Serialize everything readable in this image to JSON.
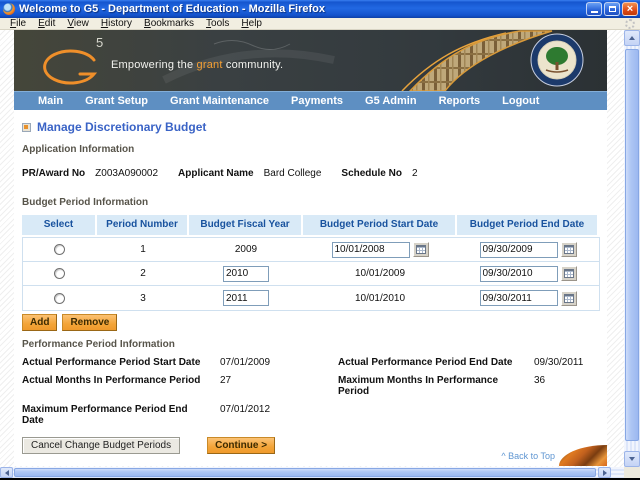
{
  "window": {
    "title": "Welcome to G5 - Department of Education - Mozilla Firefox"
  },
  "menubar": {
    "items": [
      "File",
      "Edit",
      "View",
      "History",
      "Bookmarks",
      "Tools",
      "Help"
    ]
  },
  "banner": {
    "logo_number": "5",
    "tagline_pre": "Empowering the ",
    "tagline_accent": "grant",
    "tagline_post": " community."
  },
  "nav": {
    "items": [
      "Main",
      "Grant Setup",
      "Grant Maintenance",
      "Payments",
      "G5 Admin",
      "Reports",
      "Logout"
    ]
  },
  "page": {
    "title": "Manage Discretionary Budget",
    "application_info": {
      "heading": "Application Information",
      "pr_award_label": "PR/Award No",
      "pr_award_value": "Z003A090002",
      "applicant_label": "Applicant Name",
      "applicant_value": "Bard College",
      "schedule_label": "Schedule No",
      "schedule_value": "2"
    },
    "budget_period": {
      "heading": "Budget Period Information",
      "columns": [
        "Select",
        "Period Number",
        "Budget Fiscal Year",
        "Budget Period Start Date",
        "Budget Period End Date"
      ],
      "rows": [
        {
          "period": "1",
          "fiscal_year": "2009",
          "start_date": "10/01/2008",
          "end_date": "09/30/2009"
        },
        {
          "period": "2",
          "fiscal_year": "2010",
          "start_date": "10/01/2009",
          "end_date": "09/30/2010"
        },
        {
          "period": "3",
          "fiscal_year": "2011",
          "start_date": "10/01/2010",
          "end_date": "09/30/2011"
        }
      ],
      "add_label": "Add",
      "remove_label": "Remove"
    },
    "performance": {
      "heading": "Performance Period Information",
      "fields": [
        {
          "label": "Actual Performance Period Start Date",
          "value": "07/01/2009"
        },
        {
          "label": "Actual Performance Period End Date",
          "value": "09/30/2011"
        },
        {
          "label": "Actual Months In Performance Period",
          "value": "27"
        },
        {
          "label": "Maximum Months In Performance Period",
          "value": "36"
        },
        {
          "label": "Maximum Performance Period End Date",
          "value": "07/01/2012"
        }
      ]
    },
    "actions": {
      "cancel_label": "Cancel Change Budget Periods",
      "continue_label": "Continue >"
    },
    "back_to_top": "^ Back to Top"
  },
  "colors": {
    "accent_orange": "#F49F33",
    "nav_blue": "#5E8FC2",
    "table_header_bg": "#D9EAF7",
    "page_title_blue": "#3A63C6",
    "link_blue": "#5F96D2",
    "titlebar_blue": "#1D5AD0"
  }
}
